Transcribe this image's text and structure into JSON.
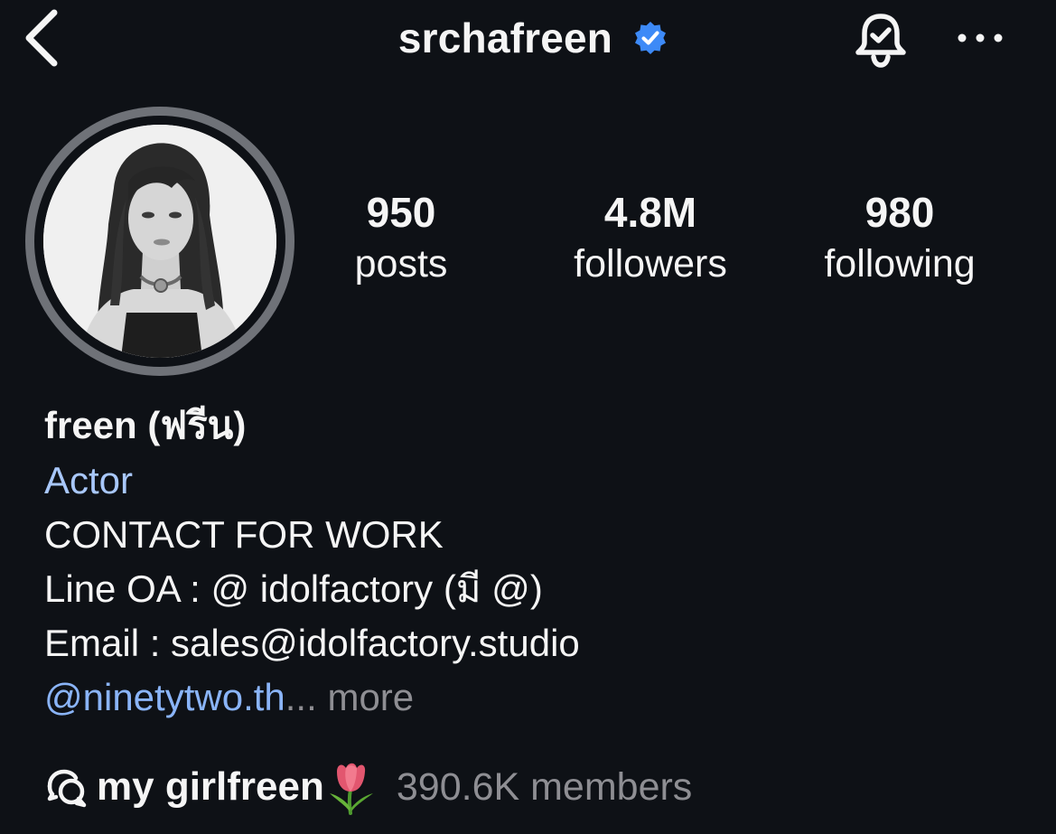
{
  "header": {
    "username": "srchafreen",
    "verified": true,
    "icons": {
      "back": "chevron-left-icon",
      "verified": "verified-badge-icon",
      "notifications": "bell-check-icon",
      "more": "more-horizontal-icon"
    }
  },
  "stats": {
    "posts": {
      "value": "950",
      "label": "posts"
    },
    "followers": {
      "value": "4.8M",
      "label": "followers"
    },
    "following": {
      "value": "980",
      "label": "following"
    }
  },
  "bio": {
    "name": "freen (ฟรีน)",
    "category": "Actor",
    "lines": [
      "CONTACT FOR WORK",
      "Line OA : @ idolfactory (มี @)",
      "Email : sales@idolfactory.studio"
    ],
    "mention": "@ninetytwo.th",
    "ellipsis": "...",
    "more_label": "more"
  },
  "channel": {
    "name": "my girlfreen",
    "emoji": "tulip-icon",
    "members": "390.6K members"
  },
  "colors": {
    "background": "#0e1116",
    "text": "#f5f5f5",
    "link": "#8ab4f8",
    "category": "#a8c7fa",
    "muted": "#8e8e93",
    "verified": "#3d8af7",
    "avatar_ring": "#6f7278"
  }
}
